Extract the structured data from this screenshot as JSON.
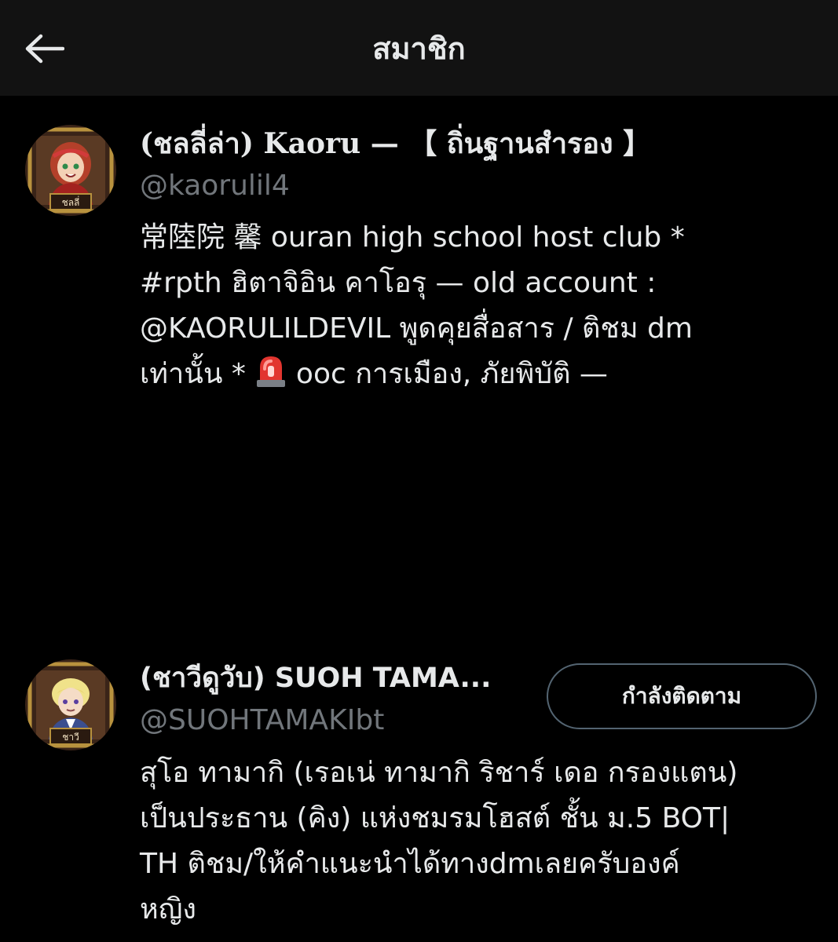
{
  "header": {
    "title": "สมาชิก",
    "back_icon": "arrow-left-icon"
  },
  "members": [
    {
      "display_name": "(ชลลี่ล่า) Kaoru — 【 ถิ่นฐานสำรอง 】",
      "handle": "@kaorulil4",
      "avatar_caption": "ชลลี่",
      "bio_lines": [
        "常陸院 馨 ouran high school host club *",
        "#rpth ฮิตาจิอิน คาโอรุ — old account :",
        "@KAORULILDEVIL พูดคุยสื่อสาร / ติชม dm",
        "เท่านั้น *",
        "ooc การเมือง, ภัยพิบัติ —"
      ],
      "bio_emoji": "siren-icon"
    },
    {
      "display_name": "(ชาวีดูวับ) SUOH TAMA...",
      "handle": "@SUOHTAMAKIbt",
      "avatar_caption": "ชาวี",
      "follow_label": "กำลังติดตาม",
      "bio_lines": [
        "สุโอ ทามากิ (เรอเน่ ทามากิ ริชาร์ เดอ กรองแตน)",
        "เป็นประธาน (คิง) แห่งชมรมโฮสต์ ชั้น ม.5 BOT|",
        "TH ติชม/ให้คำแนะนำได้ทางdmเลยครับองค์",
        "หญิง"
      ]
    }
  ],
  "colors": {
    "background": "#000000",
    "header_bg": "#121212",
    "text_primary": "#e7e9ea",
    "text_secondary": "#71767b",
    "button_border": "#536471"
  }
}
